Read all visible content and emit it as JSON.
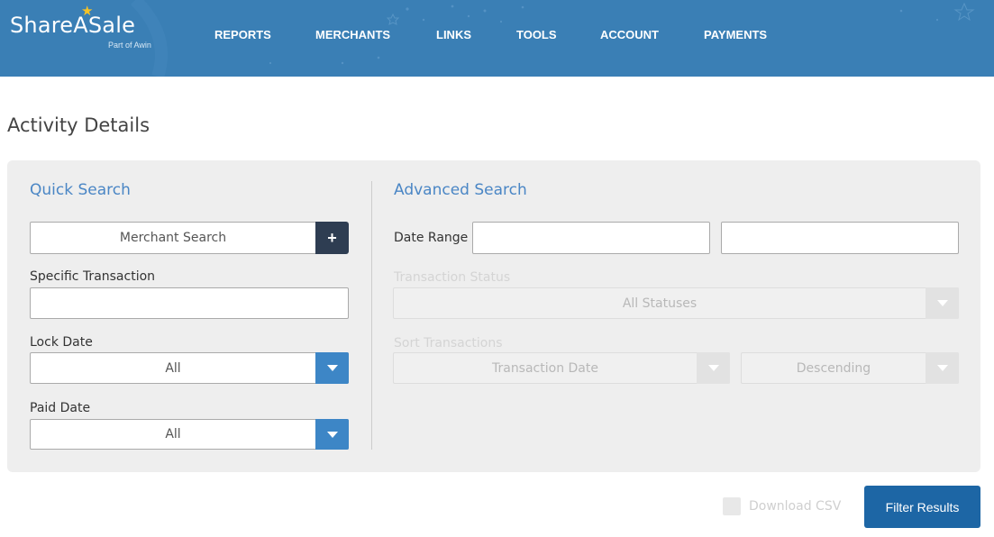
{
  "header": {
    "logo": {
      "brand": "ShareASale",
      "sub": "Part of Awin"
    },
    "nav": [
      {
        "label": "REPORTS"
      },
      {
        "label": "MERCHANTS"
      },
      {
        "label": "LINKS"
      },
      {
        "label": "TOOLS"
      },
      {
        "label": "ACCOUNT"
      },
      {
        "label": "PAYMENTS"
      }
    ],
    "colors": {
      "bar": "#3a7fb5",
      "star": "#f7c325"
    }
  },
  "page": {
    "title": "Activity Details"
  },
  "quick_search": {
    "title": "Quick Search",
    "merchant_search": {
      "value": "Merchant Search",
      "button_icon": "plus-icon"
    },
    "specific_transaction": {
      "label": "Specific Transaction",
      "value": ""
    },
    "lock_date": {
      "label": "Lock Date",
      "value": "All"
    },
    "paid_date": {
      "label": "Paid Date",
      "value": "All"
    }
  },
  "advanced_search": {
    "title": "Advanced Search",
    "date_range": {
      "label": "Date Range",
      "start": "",
      "end": ""
    },
    "transaction_status": {
      "label": "Transaction Status",
      "value": "All Statuses"
    },
    "sort": {
      "label": "Sort Transactions",
      "field": "Transaction Date",
      "order": "Descending"
    }
  },
  "footer": {
    "download_csv": {
      "label": "Download CSV",
      "checked": false
    },
    "filter_button": "Filter Results"
  }
}
